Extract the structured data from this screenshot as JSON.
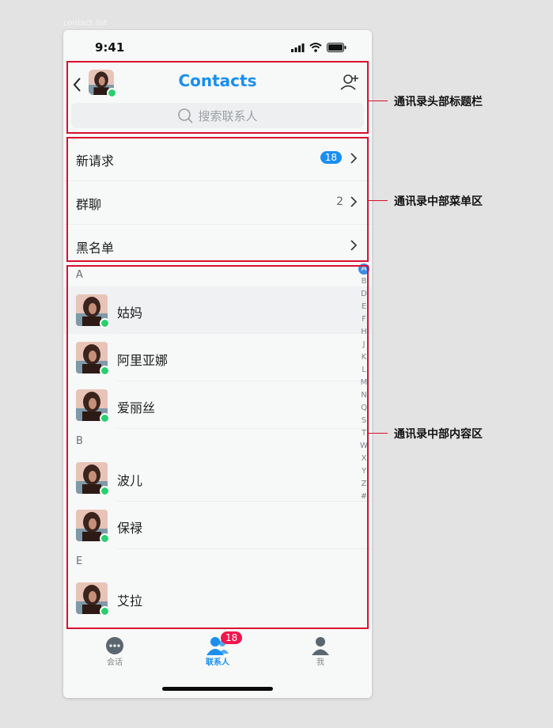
{
  "doc_label": "contact list",
  "status": {
    "time": "9:41"
  },
  "header": {
    "title": "Contacts",
    "search_placeholder": "搜索联系人"
  },
  "menu": [
    {
      "label": "新请求",
      "badge": "18"
    },
    {
      "label": "群聊",
      "count": "2"
    },
    {
      "label": "黑名单"
    }
  ],
  "sections": [
    {
      "letter": "A",
      "contacts": [
        "姑妈",
        "阿里亚娜",
        "爱丽丝"
      ]
    },
    {
      "letter": "B",
      "contacts": [
        "波儿",
        "保禄"
      ]
    },
    {
      "letter": "E",
      "contacts": [
        "艾拉"
      ]
    }
  ],
  "index_letters": [
    "A",
    "B",
    "D",
    "E",
    "F",
    "H",
    "J",
    "K",
    "L",
    "M",
    "N",
    "Q",
    "S",
    "T",
    "W",
    "X",
    "Y",
    "Z",
    "#"
  ],
  "index_active": "A",
  "tabs": [
    {
      "label": "会话",
      "icon": "chat-icon"
    },
    {
      "label": "联系人",
      "icon": "contacts-icon",
      "badge": "18",
      "active": true
    },
    {
      "label": "我",
      "icon": "profile-icon"
    }
  ],
  "annotations": {
    "header": "通讯录头部标题栏",
    "menu": "通讯录中部菜单区",
    "content": "通讯录中部内容区"
  },
  "colors": {
    "accent": "#1a8ff0",
    "online": "#27d06f",
    "badge_red": "#f0174c",
    "annotation": "#d9112e"
  }
}
